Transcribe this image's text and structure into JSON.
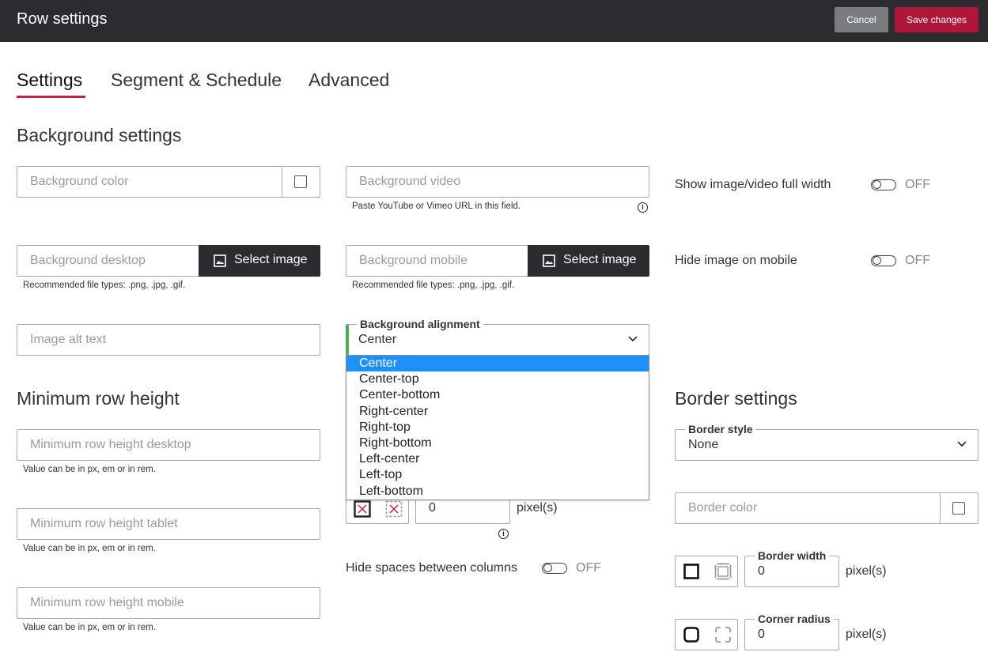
{
  "header": {
    "title": "Row settings",
    "cancel_label": "Cancel",
    "save_label": "Save changes"
  },
  "tabs": [
    {
      "label": "Settings",
      "active": true
    },
    {
      "label": "Segment & Schedule"
    },
    {
      "label": "Advanced"
    }
  ],
  "background": {
    "section_title": "Background settings",
    "color_placeholder": "Background color",
    "video_placeholder": "Background video",
    "video_hint": "Paste YouTube or Vimeo URL in this field.",
    "full_width_label": "Show image/video full width",
    "full_width_state": "OFF",
    "desktop_placeholder": "Background desktop",
    "select_image_label": "Select image",
    "desktop_hint": "Recommended file types: .png, .jpg, .gif.",
    "mobile_placeholder": "Background mobile",
    "mobile_hint": "Recommended file types: .png, .jpg, .gif.",
    "hide_mobile_label": "Hide image on mobile",
    "hide_mobile_state": "OFF",
    "alt_placeholder": "Image alt text",
    "alignment_label": "Background alignment",
    "alignment_value": "Center",
    "alignment_options": [
      "Center",
      "Center-top",
      "Center-bottom",
      "Right-center",
      "Right-top",
      "Right-bottom",
      "Left-center",
      "Left-top",
      "Left-bottom"
    ]
  },
  "min_height": {
    "section_title": "Minimum row height",
    "desktop_placeholder": "Minimum row height desktop",
    "tablet_placeholder": "Minimum row height tablet",
    "mobile_placeholder": "Minimum row height mobile",
    "hint": "Value can be in px, em or in rem."
  },
  "spacing": {
    "value": "0",
    "unit": "pixel(s)",
    "hide_spaces_label": "Hide spaces between columns",
    "hide_spaces_state": "OFF"
  },
  "border": {
    "section_title": "Border settings",
    "style_label": "Border style",
    "style_value": "None",
    "color_placeholder": "Border color",
    "width_label": "Border width",
    "width_value": "0",
    "width_unit": "pixel(s)",
    "radius_label": "Corner radius",
    "radius_value": "0",
    "radius_unit": "pixel(s)"
  },
  "colors": {
    "accent": "#c8213e",
    "save": "#b0163a",
    "dark": "#2c2c30",
    "selected": "#1e90ff",
    "focus": "#4caf50"
  }
}
